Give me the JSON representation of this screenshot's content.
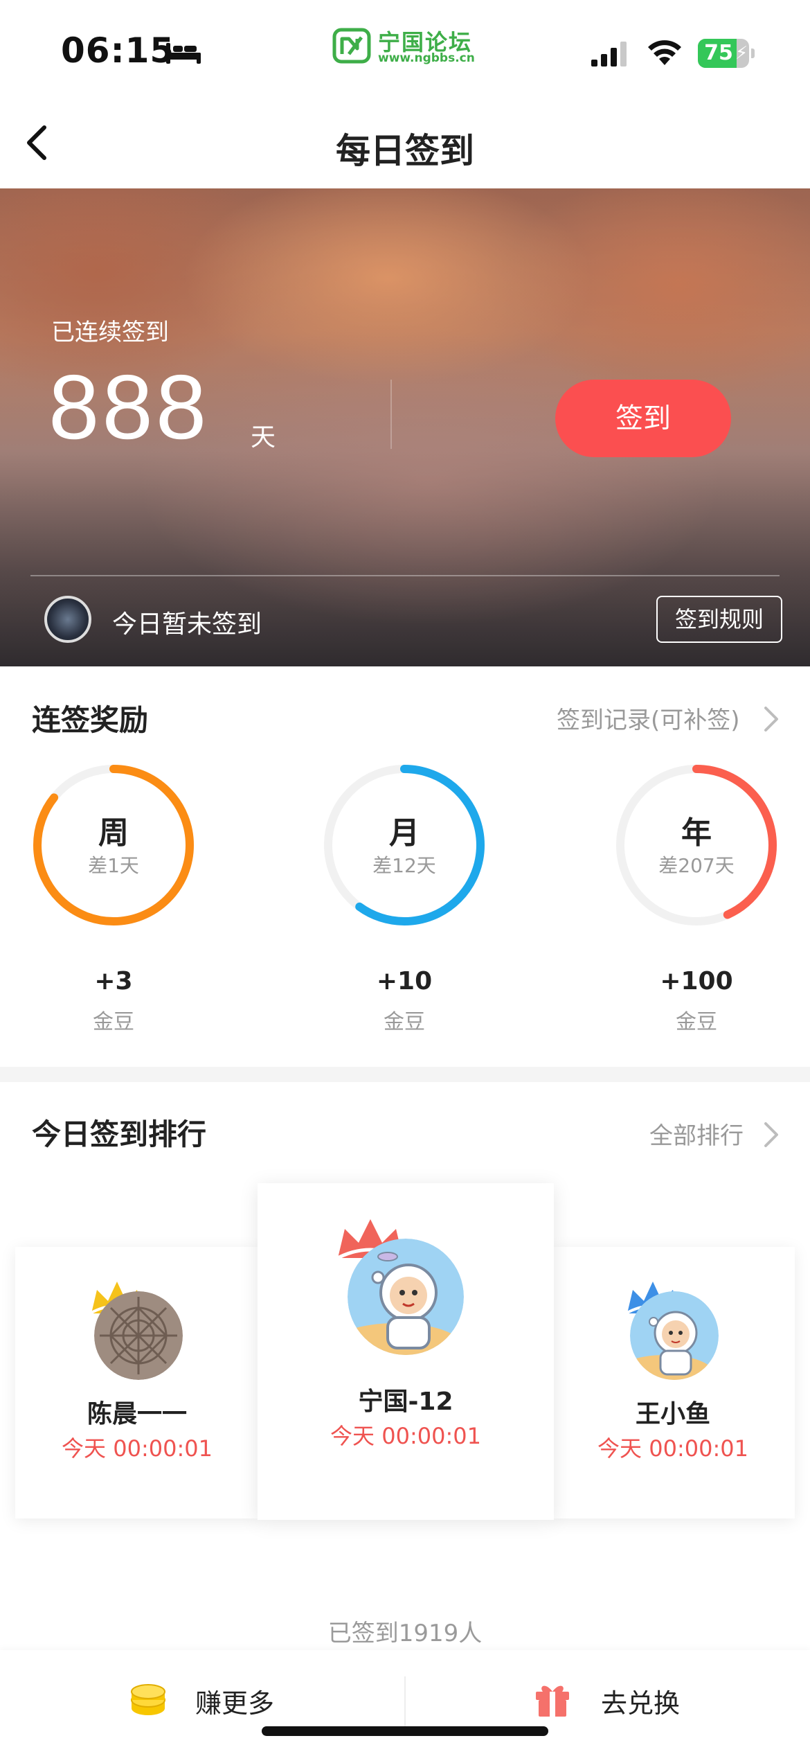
{
  "status_bar": {
    "time": "06:15",
    "battery_level": 75,
    "battery_text": "75",
    "icons": [
      "bed-icon",
      "signal-icon",
      "wifi-icon",
      "battery-icon"
    ]
  },
  "brand": {
    "name": "宁国论坛",
    "url": "www.ngbbs.cn",
    "color": "#3eae48"
  },
  "nav": {
    "title": "每日签到",
    "back_icon": "chevron-left-icon"
  },
  "hero": {
    "streak_label": "已连续签到",
    "streak_count": "888",
    "streak_unit": "天",
    "checkin_label": "签到",
    "status_text": "今日暂未签到",
    "rules_label": "签到规则",
    "accent": "#fb4f50"
  },
  "rewards": {
    "title": "连签奖励",
    "link": "签到记录(可补签)",
    "items": [
      {
        "label": "周",
        "sub": "差1天",
        "amount": "+3",
        "unit": "金豆",
        "progress": 0.857,
        "color": "#fb8c14"
      },
      {
        "label": "月",
        "sub": "差12天",
        "amount": "+10",
        "unit": "金豆",
        "progress": 0.6,
        "color": "#1ea8eb"
      },
      {
        "label": "年",
        "sub": "差207天",
        "amount": "+100",
        "unit": "金豆",
        "progress": 0.433,
        "color": "#fb5f4e"
      }
    ]
  },
  "ranking": {
    "title": "今日签到排行",
    "link": "全部排行",
    "podium": [
      {
        "rank": 2,
        "name": "陈晨一一",
        "time": "今天 00:00:01",
        "crown_color": "#f5c21b"
      },
      {
        "rank": 1,
        "name": "宁国-12",
        "time": "今天 00:00:01",
        "crown_color": "#f0645a"
      },
      {
        "rank": 3,
        "name": "王小鱼",
        "time": "今天 00:00:01",
        "crown_color": "#3d8fe6"
      }
    ],
    "signed_count": "已签到1919人"
  },
  "bottom_bar": {
    "earn_label": "赚更多",
    "exchange_label": "去兑换",
    "earn_icon": "coin-stack-icon",
    "exchange_icon": "gift-icon"
  }
}
